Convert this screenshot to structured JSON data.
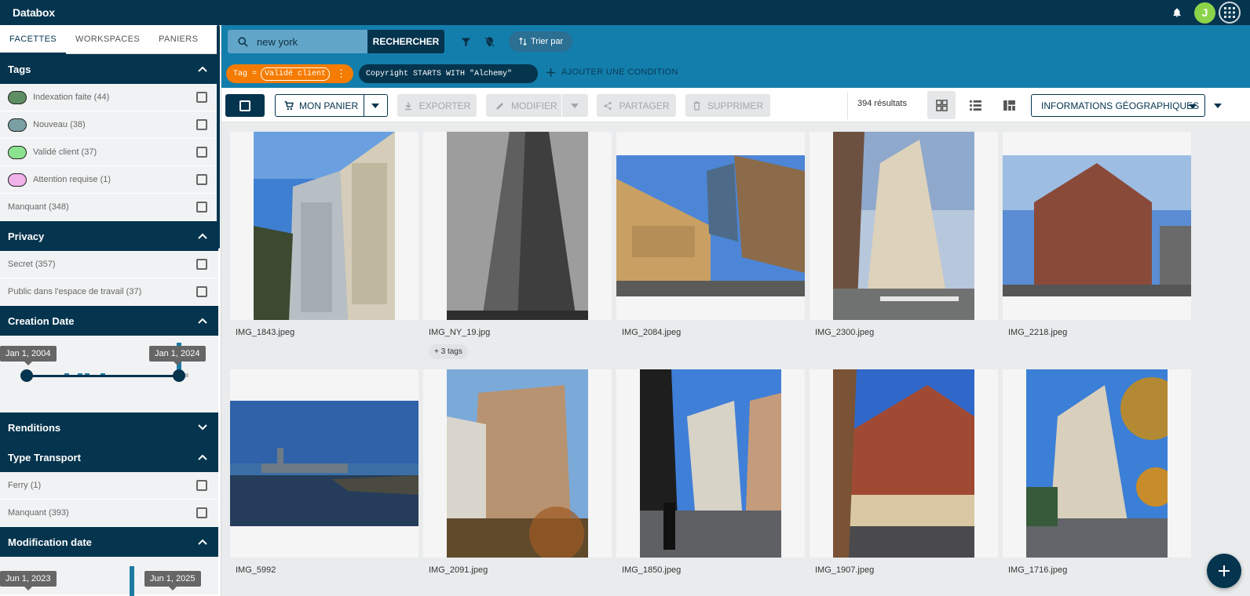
{
  "app": {
    "title": "Databox",
    "avatar_letter": "J"
  },
  "sidebar": {
    "tabs": [
      "FACETTES",
      "WORKSPACES",
      "PANIERS"
    ],
    "tags": {
      "title": "Tags",
      "items": [
        {
          "label": "Indexation faite (44)",
          "color": "#5e8f63"
        },
        {
          "label": "Nouveau (38)",
          "color": "#7aa0a3"
        },
        {
          "label": "Validé client (37)",
          "color": "#8be38f"
        },
        {
          "label": "Attention requise (1)",
          "color": "#f0b2e8"
        },
        {
          "label": "Manquant (348)",
          "color": ""
        }
      ]
    },
    "privacy": {
      "title": "Privacy",
      "items": [
        "Secret (357)",
        "Public dans l'espace de travail (37)"
      ]
    },
    "creation_date": {
      "title": "Creation Date",
      "from": "Jan 1, 2004",
      "to": "Jan 1, 2024"
    },
    "renditions": {
      "title": "Renditions"
    },
    "transport": {
      "title": "Type Transport",
      "items": [
        "Ferry (1)",
        "Manquant (393)"
      ]
    },
    "modification_date": {
      "title": "Modification date",
      "from": "Jun 1, 2023",
      "to": "Jun 1, 2025"
    }
  },
  "search": {
    "query": "new york",
    "button": "RECHERCHER",
    "sort_label": "Trier par",
    "conditions": {
      "tag_prefix": "Tag =",
      "tag_value": "Validé client",
      "copyright": "Copyright STARTS WITH \"Alchemy\""
    },
    "add_condition": "AJOUTER UNE CONDITION"
  },
  "toolbar": {
    "basket": "MON PANIER",
    "export": "EXPORTER",
    "modify": "MODIFIER",
    "share": "PARTAGER",
    "delete": "SUPPRIMER",
    "results": "394 résultats",
    "geo": "INFORMATIONS GÉOGRAPHIQUES"
  },
  "assets": [
    {
      "name": "IMG_1843.jpeg",
      "tags": ""
    },
    {
      "name": "IMG_NY_19.jpg",
      "tags": "+ 3 tags"
    },
    {
      "name": "IMG_2084.jpeg",
      "tags": ""
    },
    {
      "name": "IMG_2300.jpeg",
      "tags": ""
    },
    {
      "name": "IMG_2218.jpeg",
      "tags": ""
    },
    {
      "name": "IMG_5992",
      "tags": ""
    },
    {
      "name": "IMG_2091.jpeg",
      "tags": ""
    },
    {
      "name": "IMG_1850.jpeg",
      "tags": ""
    },
    {
      "name": "IMG_1907.jpeg",
      "tags": ""
    },
    {
      "name": "IMG_1716.jpeg",
      "tags": ""
    }
  ]
}
